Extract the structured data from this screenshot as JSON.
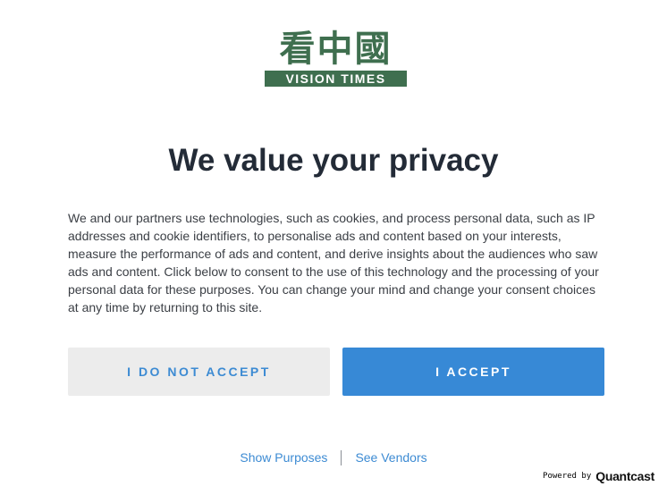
{
  "logo": {
    "chinese_text": "看中國",
    "english_text": "VISION TIMES",
    "color": "#3f6f4f"
  },
  "title": "We value your privacy",
  "description": "We and our partners use technologies, such as cookies, and process personal data, such as IP addresses and cookie identifiers, to personalise ads and content based on your interests, measure the performance of ads and content, and derive insights about the audiences who saw ads and content. Click below to consent to the use of this technology and the processing of your personal data for these purposes. You can change your mind and change your consent choices at any time by returning to this site.",
  "buttons": {
    "reject_label": "I DO NOT ACCEPT",
    "accept_label": "I ACCEPT"
  },
  "links": {
    "purposes_label": "Show Purposes",
    "vendors_label": "See Vendors"
  },
  "powered_by": {
    "label": "Powered by",
    "brand": "Quantcast"
  },
  "colors": {
    "accent": "#3789d6",
    "link": "#3d8bd3",
    "reject_bg": "#ececec",
    "title": "#232b37"
  }
}
